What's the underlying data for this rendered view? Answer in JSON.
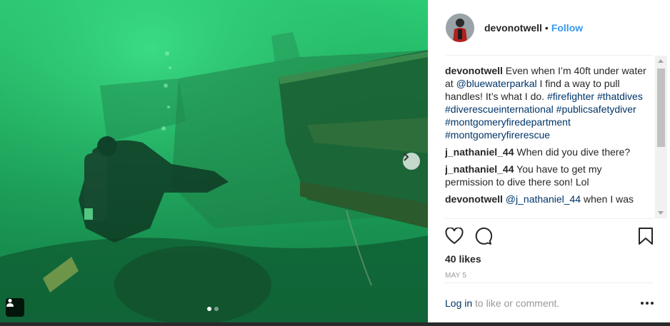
{
  "post": {
    "username": "devonotwell",
    "separator": "•",
    "follow_label": "Follow"
  },
  "comments": [
    {
      "user": "devonotwell",
      "text_parts": [
        {
          "t": "Even when I’m 40ft under water at ",
          "tag": false
        },
        {
          "t": "@bluewaterparkal",
          "tag": true
        },
        {
          "t": " I find a way to pull handles! It’s what I do. ",
          "tag": false
        },
        {
          "t": "#firefighter",
          "tag": true
        },
        {
          "t": " ",
          "tag": false
        },
        {
          "t": "#thatdives",
          "tag": true
        },
        {
          "t": " ",
          "tag": false
        },
        {
          "t": "#diverescueinternational",
          "tag": true
        },
        {
          "t": " ",
          "tag": false
        },
        {
          "t": "#publicsafetydiver",
          "tag": true
        },
        {
          "t": " ",
          "tag": false
        },
        {
          "t": "#montgomeryfiredepartment",
          "tag": true
        },
        {
          "t": " ",
          "tag": false
        },
        {
          "t": "#montgomeryfirerescue",
          "tag": true
        }
      ]
    },
    {
      "user": "j_nathaniel_44",
      "text_parts": [
        {
          "t": "When did you dive there?",
          "tag": false
        }
      ]
    },
    {
      "user": "j_nathaniel_44",
      "text_parts": [
        {
          "t": "You have to get my permission to dive there son! Lol",
          "tag": false
        }
      ]
    },
    {
      "user": "devonotwell",
      "text_parts": [
        {
          "t": "@j_nathaniel_44",
          "tag": true
        },
        {
          "t": " when I was",
          "tag": false
        }
      ]
    }
  ],
  "likes_label": "40 likes",
  "date_label": "MAY 5",
  "footer": {
    "login_label": "Log in",
    "rest_label": " to like or comment."
  },
  "icons": {
    "like": "heart-icon",
    "comment": "comment-bubble-icon",
    "save": "bookmark-icon",
    "next": "chevron-right-icon",
    "user_tag": "person-icon",
    "more": "more-options-icon"
  },
  "colors": {
    "link": "#3897f0",
    "hashtag": "#003569",
    "text": "#262626",
    "muted": "#999999"
  },
  "carousel": {
    "count": 2,
    "active": 1
  }
}
